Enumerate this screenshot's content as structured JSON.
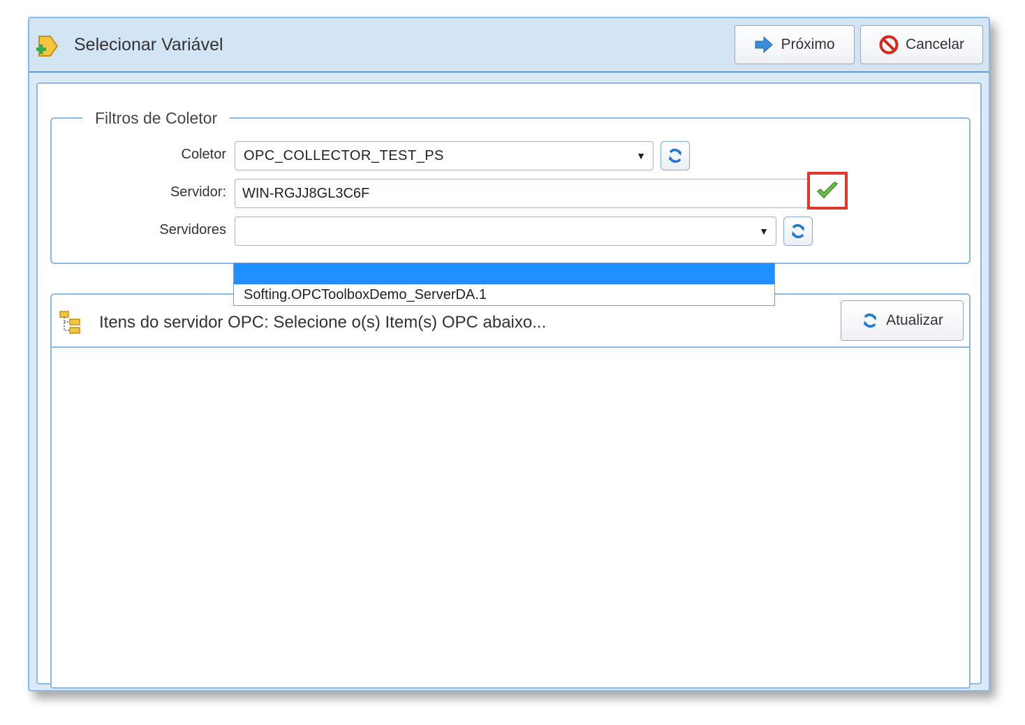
{
  "dialog": {
    "title": "Selecionar Variável",
    "buttons": {
      "next": "Próximo",
      "cancel": "Cancelar"
    }
  },
  "filters": {
    "legend": "Filtros de Coletor",
    "collector": {
      "label": "Coletor",
      "value": "OPC_COLLECTOR_TEST_PS"
    },
    "server": {
      "label": "Servidor:",
      "value": "WIN-RGJJ8GL3C6F"
    },
    "servers": {
      "label": "Servidores",
      "value": "",
      "options": [
        "",
        "Softing.OPCToolboxDemo_ServerDA.1"
      ]
    }
  },
  "items": {
    "title": "Itens do servidor OPC: Selecione o(s) Item(s) OPC abaixo...",
    "update_label": "Atualizar"
  },
  "icons": {
    "title": "variable-add-icon",
    "next": "arrow-right-icon",
    "cancel": "no-entry-icon",
    "refresh": "refresh-icon",
    "validate": "check-icon",
    "items": "tree-icon"
  },
  "colors": {
    "accent": "#1e90ff",
    "highlight_border": "#e0362b",
    "panel_border": "#8db8e2"
  }
}
